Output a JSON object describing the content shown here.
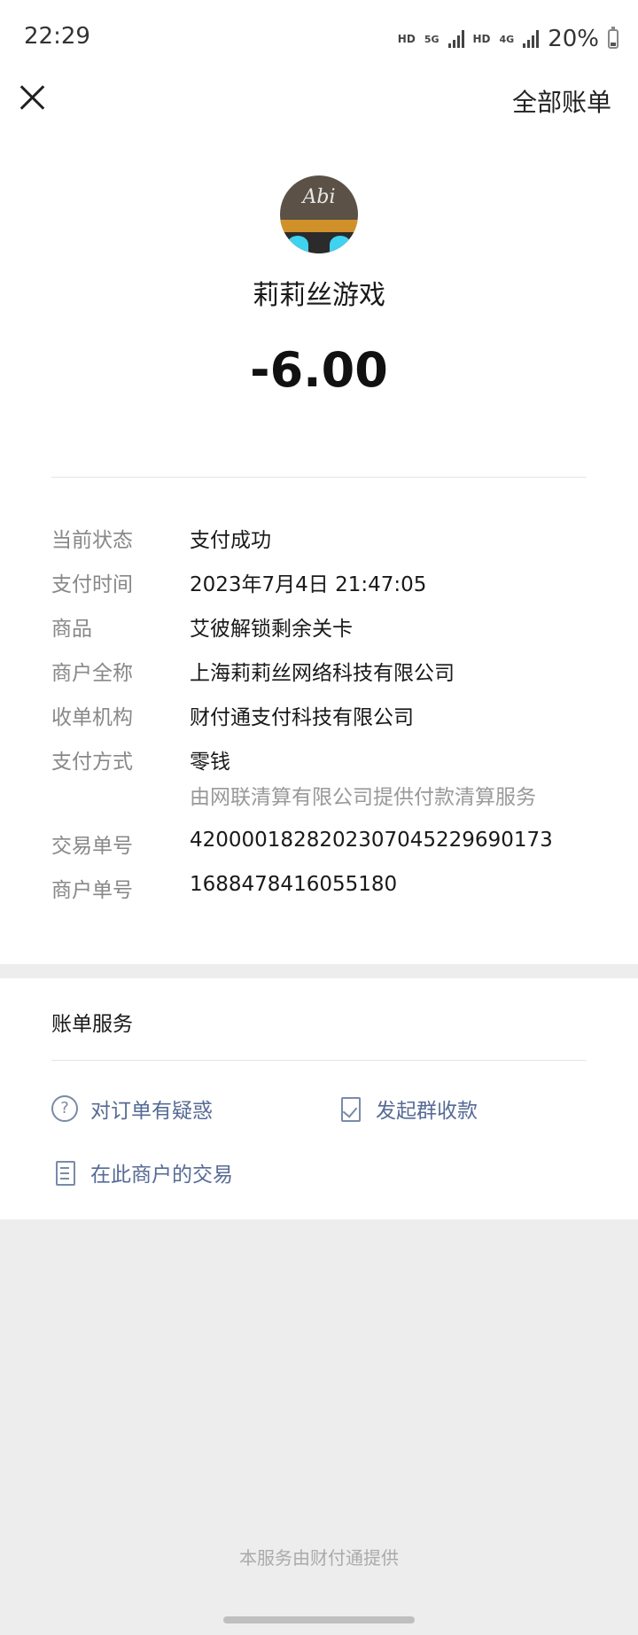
{
  "status_bar": {
    "time": "22:29",
    "hd1": "HD",
    "net1": "5G",
    "hd2": "HD",
    "net2": "4G",
    "battery": "20%"
  },
  "nav": {
    "all_bills": "全部账单"
  },
  "merchant": {
    "avatar_text": "Abi",
    "name": "莉莉丝游戏",
    "amount": "-6.00"
  },
  "details": [
    {
      "label": "当前状态",
      "value": "支付成功"
    },
    {
      "label": "支付时间",
      "value": "2023年7月4日 21:47:05"
    },
    {
      "label": "商品",
      "value": "艾彼解锁剩余关卡"
    },
    {
      "label": "商户全称",
      "value": "上海莉莉丝网络科技有限公司"
    },
    {
      "label": "收单机构",
      "value": "财付通支付科技有限公司"
    },
    {
      "label": "支付方式",
      "value": "零钱",
      "sub": "由网联清算有限公司提供付款清算服务"
    },
    {
      "label": "交易单号",
      "value": "4200001828202307045229690173"
    },
    {
      "label": "商户单号",
      "value": "1688478416055180"
    }
  ],
  "services": {
    "title": "账单服务",
    "items": [
      {
        "label": "对订单有疑惑",
        "icon": "question-icon"
      },
      {
        "label": "发起群收款",
        "icon": "group-collect-icon"
      },
      {
        "label": "在此商户的交易",
        "icon": "document-icon"
      }
    ]
  },
  "footer": "本服务由财付通提供"
}
